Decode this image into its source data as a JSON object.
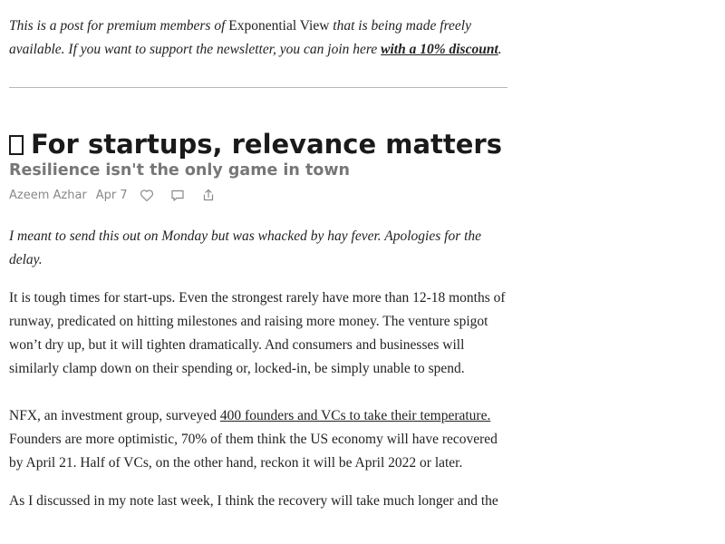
{
  "intro": {
    "part1": "This is a post for premium members of ",
    "brand": "Exponential View",
    "part2": " that is being made freely available. If you want to support the newsletter, you can join here ",
    "link": "with a 10% discount",
    "part3": "."
  },
  "post": {
    "title": "For startups, relevance matters",
    "subtitle": "Resilience isn't the only game in town",
    "author": "Azeem Azhar",
    "date": "Apr 7",
    "icons": [
      "heart-icon",
      "comment-icon",
      "share-icon"
    ]
  },
  "body": {
    "p1": "I meant to send this out on Monday but was whacked by hay fever. Apologies for the delay.",
    "p2": "It is tough times for start-ups. Even the strongest rarely have more than 12-18 months of runway, predicated on hitting milestones and raising more money. The venture spigot won’t dry up, but it will tighten dramatically. And consumers and businesses will similarly clamp down on their spending or, locked-in, be simply unable to spend.",
    "p3_before": "NFX, an investment group, surveyed ",
    "p3_link": "400 founders and VCs to take their temperature.",
    "p3_after": " Founders are more optimistic, 70% of them think the US economy will have recovered by April 21. Half of VCs, on the other hand, reckon it will be April 2022 or later.",
    "p4_start": "As I discussed in my note last week, I think the recovery will take much longer and the"
  }
}
